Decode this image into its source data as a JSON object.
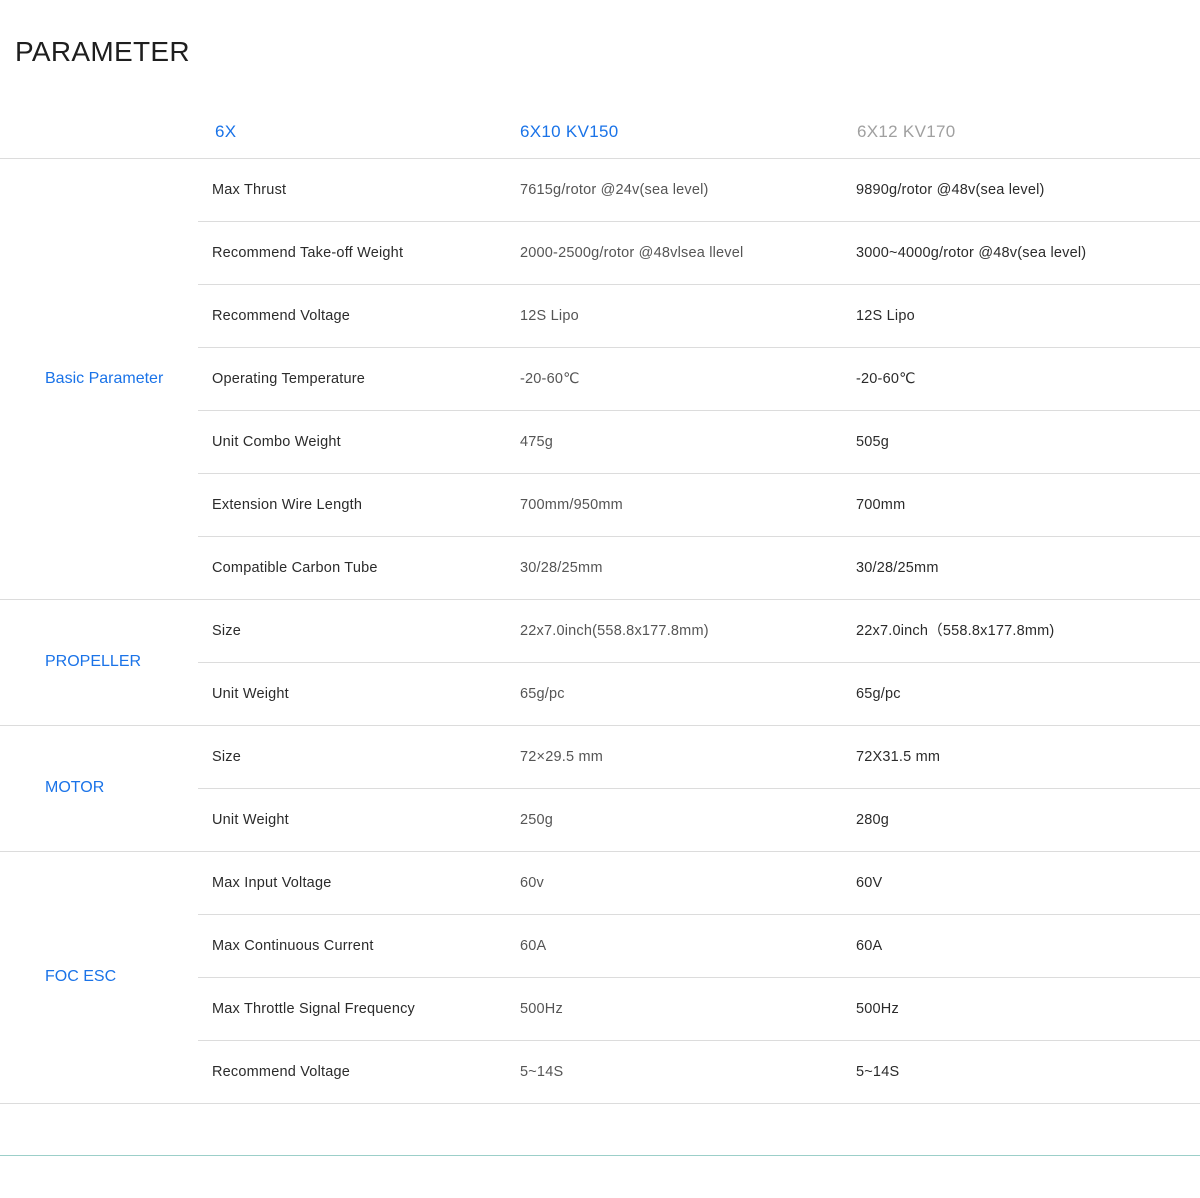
{
  "page": {
    "title": "PARAMETER"
  },
  "colors": {
    "accent": "#1a73e8",
    "muted": "#a0a0a0",
    "divider": "#dcdcdc"
  },
  "header": [
    {
      "label": "6X",
      "color": "#1a73e8"
    },
    {
      "label": "6X10 KV150",
      "color": "#1a73e8"
    },
    {
      "label": "6X12 KV170",
      "color": "#a0a0a0"
    }
  ],
  "groups": [
    {
      "name": "Basic Parameter",
      "rows": [
        {
          "label": "Max Thrust",
          "v1": "7615g/rotor @24v(sea level)",
          "v2": "9890g/rotor @48v(sea level)"
        },
        {
          "label": "Recommend Take-off Weight",
          "v1": "2000-2500g/rotor @48vlsea llevel",
          "v2": "3000~4000g/rotor @48v(sea level)"
        },
        {
          "label": "Recommend Voltage",
          "v1": "12S Lipo",
          "v2": "12S Lipo"
        },
        {
          "label": "Operating Temperature",
          "v1": "-20-60℃",
          "v2": "-20-60℃"
        },
        {
          "label": "Unit Combo Weight",
          "v1": "475g",
          "v2": "505g"
        },
        {
          "label": "Extension Wire Length",
          "v1": "700mm/950mm",
          "v2": "700mm"
        },
        {
          "label": "Compatible Carbon Tube",
          "v1": "30/28/25mm",
          "v2": "30/28/25mm"
        }
      ]
    },
    {
      "name": "PROPELLER",
      "rows": [
        {
          "label": "Size",
          "v1": "22x7.0inch(558.8x177.8mm)",
          "v2": "22x7.0inch（558.8x177.8mm)"
        },
        {
          "label": "Unit Weight",
          "v1": "65g/pc",
          "v2": "65g/pc"
        }
      ]
    },
    {
      "name": "MOTOR",
      "rows": [
        {
          "label": "Size",
          "v1": "72×29.5 mm",
          "v2": "72X31.5 mm"
        },
        {
          "label": "Unit Weight",
          "v1": "250g",
          "v2": "280g"
        }
      ]
    },
    {
      "name": "FOC ESC",
      "rows": [
        {
          "label": "Max Input Voltage",
          "v1": "60v",
          "v2": "60V"
        },
        {
          "label": "Max Continuous Current",
          "v1": "60A",
          "v2": "60A"
        },
        {
          "label": "Max Throttle Signal Frequency",
          "v1": "500Hz",
          "v2": "500Hz"
        },
        {
          "label": "Recommend Voltage",
          "v1": "5~14S",
          "v2": "5~14S"
        }
      ]
    }
  ]
}
